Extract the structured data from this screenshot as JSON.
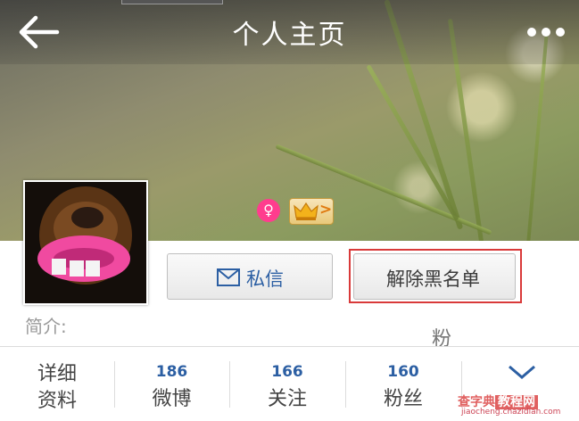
{
  "header": {
    "title": "个人主页",
    "back_icon": "arrow-left-icon",
    "more_icon": "more-dots-icon"
  },
  "profile": {
    "gender_badge": "female-icon",
    "vip_badge": "crown-icon",
    "vip_arrow": ">"
  },
  "actions": {
    "message_label": "私信",
    "message_icon": "envelope-icon",
    "unblock_label": "解除黑名单"
  },
  "bio": {
    "label": "简介:"
  },
  "stats": {
    "detail_line1": "详细",
    "detail_line2": "资料",
    "items": [
      {
        "count": "186",
        "label": "微博"
      },
      {
        "count": "166",
        "label": "关注"
      },
      {
        "count": "160",
        "label": "粉丝"
      }
    ],
    "partial_text": "粉"
  },
  "watermark": {
    "line1_a": "查字典",
    "line1_b": "教程网",
    "line2": "jiaocheng.chazidian.com"
  },
  "colors": {
    "accent_blue": "#2c5fa3",
    "gender_pink": "#ff3c8e",
    "highlight_red": "#d93a3a"
  }
}
